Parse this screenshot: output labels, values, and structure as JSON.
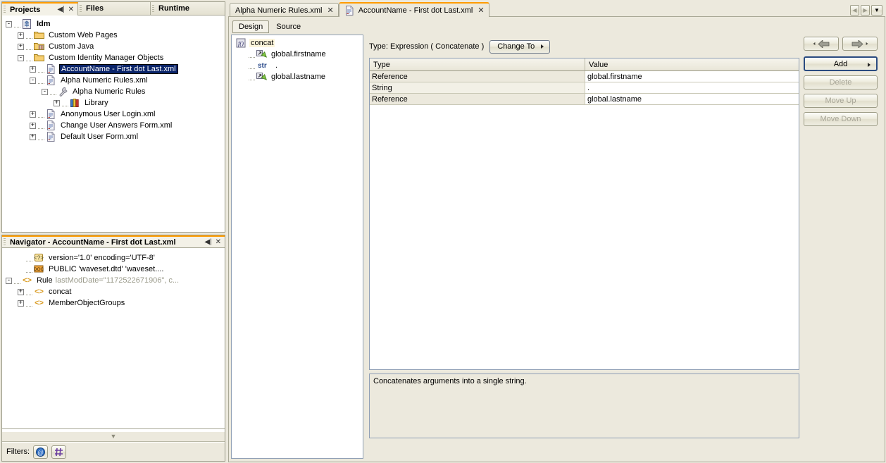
{
  "projects_panel": {
    "tabs": [
      {
        "label": "Projects",
        "active": true
      },
      {
        "label": "Files",
        "active": false
      },
      {
        "label": "Runtime",
        "active": false
      }
    ],
    "minimize_glyph": "◀|",
    "close_glyph": "✕",
    "tree": [
      {
        "label": "Idm",
        "icon": "project-icon",
        "depth": 0,
        "expander": "-",
        "bold": true
      },
      {
        "label": "Custom Web Pages",
        "icon": "folder-icon",
        "depth": 1,
        "expander": "+"
      },
      {
        "label": "Custom Java",
        "icon": "java-folder-icon",
        "depth": 1,
        "expander": "+"
      },
      {
        "label": "Custom Identity Manager Objects",
        "icon": "folder-icon",
        "depth": 1,
        "expander": "-"
      },
      {
        "label": "AccountName - First dot Last.xml",
        "icon": "xml-file-icon",
        "depth": 2,
        "expander": "+",
        "selected": true
      },
      {
        "label": "Alpha Numeric Rules.xml",
        "icon": "xml-file-icon",
        "depth": 2,
        "expander": "-"
      },
      {
        "label": "Alpha Numeric Rules",
        "icon": "wrench-icon",
        "depth": 3,
        "expander": "-"
      },
      {
        "label": "Library",
        "icon": "library-icon",
        "depth": 4,
        "expander": "+"
      },
      {
        "label": "Anonymous User Login.xml",
        "icon": "xml-file-icon",
        "depth": 2,
        "expander": "+"
      },
      {
        "label": "Change User Answers Form.xml",
        "icon": "xml-file-icon",
        "depth": 2,
        "expander": "+"
      },
      {
        "label": "Default User Form.xml",
        "icon": "xml-file-icon",
        "depth": 2,
        "expander": "+"
      }
    ]
  },
  "navigator_panel": {
    "title": "Navigator - AccountName - First dot Last.xml",
    "minimize_glyph": "◀|",
    "close_glyph": "✕",
    "tree": [
      {
        "label": "version='1.0' encoding='UTF-8'",
        "icon": "xml-decl-icon",
        "depth": 1,
        "expander": ""
      },
      {
        "label": "PUBLIC 'waveset.dtd' 'waveset....",
        "icon": "doctype-icon",
        "depth": 1,
        "expander": ""
      },
      {
        "label": "Rule",
        "detail": "lastModDate=\"1172522671906\", c...",
        "icon": "element-icon",
        "depth": 0,
        "expander": "-"
      },
      {
        "label": "concat",
        "icon": "element-icon",
        "depth": 1,
        "expander": "+"
      },
      {
        "label": "MemberObjectGroups",
        "icon": "element-icon",
        "depth": 1,
        "expander": "+"
      }
    ],
    "filters_label": "Filters:",
    "filter_buttons": [
      "at-filter-icon",
      "grid-filter-icon"
    ],
    "collapse_glyph": "▼"
  },
  "editor": {
    "tabs": [
      {
        "label": "Alpha Numeric Rules.xml",
        "active": false,
        "close_glyph": "✕",
        "icon": null
      },
      {
        "label": "AccountName - First dot Last.xml",
        "active": true,
        "close_glyph": "✕",
        "icon": "xml-file-icon"
      }
    ],
    "tabstrip_left_arrow": "◀",
    "tabstrip_right_arrow": "▶",
    "tabstrip_dropdown": "▼",
    "subtabs": [
      {
        "label": "Design",
        "active": true
      },
      {
        "label": "Source",
        "active": false
      }
    ],
    "design_tree": [
      {
        "label": "concat",
        "icon": "function-icon",
        "depth": 0,
        "highlight": true
      },
      {
        "label": "global.firstname",
        "icon": "reference-icon",
        "depth": 1
      },
      {
        "label": ".",
        "icon": "str-icon",
        "icon_text": "str",
        "depth": 1
      },
      {
        "label": "global.lastname",
        "icon": "reference-icon",
        "depth": 1
      }
    ],
    "type_label": "Type: Expression ( Concatenate )",
    "change_to_button": "Change To",
    "table": {
      "columns": [
        "Type",
        "Value"
      ],
      "rows": [
        {
          "type": "Reference",
          "value": "global.firstname"
        },
        {
          "type": "String",
          "value": "."
        },
        {
          "type": "Reference",
          "value": "global.lastname"
        }
      ]
    },
    "side_buttons": {
      "back_icon": "back-arrow-icon",
      "forward_icon": "forward-arrow-icon",
      "add": "Add",
      "delete": "Delete",
      "move_up": "Move Up",
      "move_down": "Move Down"
    },
    "description": "Concatenates arguments into a single string."
  },
  "colors": {
    "background": "#ece9dd",
    "selection": "#0a246a",
    "active_tab_accent": "#ff9c00",
    "focus_border": "#2a4b80"
  }
}
